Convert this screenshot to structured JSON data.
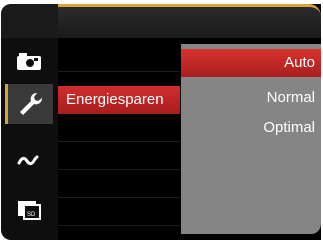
{
  "sidebar": {
    "items": [
      {
        "icon": "camera-icon",
        "active": false
      },
      {
        "icon": "wrench-icon",
        "active": true
      },
      {
        "icon": "connectivity-icon",
        "active": false
      },
      {
        "icon": "sd-card-icon",
        "active": false
      }
    ]
  },
  "menu": {
    "selected_label": "Energiesparen"
  },
  "options": {
    "items": [
      "Auto",
      "Normal",
      "Optimal"
    ],
    "selected_index": 0
  },
  "colors": {
    "accent": "#d9a23a",
    "highlight": "#c42626",
    "panel": "#858585",
    "background": "#000000"
  }
}
